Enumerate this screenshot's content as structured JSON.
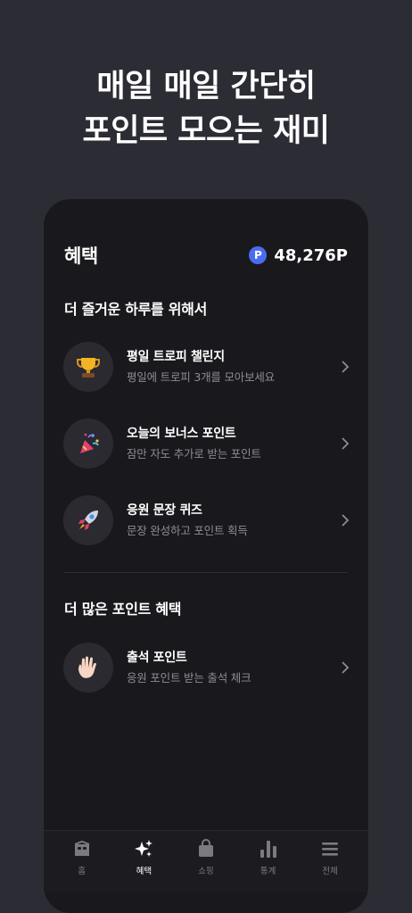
{
  "hero": {
    "line1": "매일 매일 간단히",
    "line2": "포인트 모으는 재미"
  },
  "header": {
    "title": "혜택",
    "points_badge": "P",
    "points_value": "48,276P"
  },
  "sections": [
    {
      "title": "더 즐거운 하루를 위해서",
      "items": [
        {
          "icon": "trophy-icon",
          "title": "평일 트로피 챌린지",
          "subtitle": "평일에 트로피 3개를 모아보세요"
        },
        {
          "icon": "party-popper-icon",
          "title": "오늘의 보너스 포인트",
          "subtitle": "잠만 자도 추가로 받는 포인트"
        },
        {
          "icon": "rocket-icon",
          "title": "응원 문장 퀴즈",
          "subtitle": "문장 완성하고 포인트 획득"
        }
      ]
    },
    {
      "title": "더 많은 포인트 혜택",
      "items": [
        {
          "icon": "waving-hand-icon",
          "title": "출석 포인트",
          "subtitle": "응원 포인트 받는 출석 체크"
        }
      ]
    }
  ],
  "tabbar": {
    "active": "혜택",
    "tabs": [
      {
        "label": "홈",
        "icon": "home-icon"
      },
      {
        "label": "혜택",
        "icon": "sparkle-icon"
      },
      {
        "label": "쇼핑",
        "icon": "shopping-bag-icon"
      },
      {
        "label": "통계",
        "icon": "bar-chart-icon"
      },
      {
        "label": "전체",
        "icon": "menu-icon"
      }
    ]
  },
  "colors": {
    "background": "#2c2c34",
    "card": "#19191d",
    "accent": "#4a6cf0",
    "subtext": "#8c8c94"
  }
}
